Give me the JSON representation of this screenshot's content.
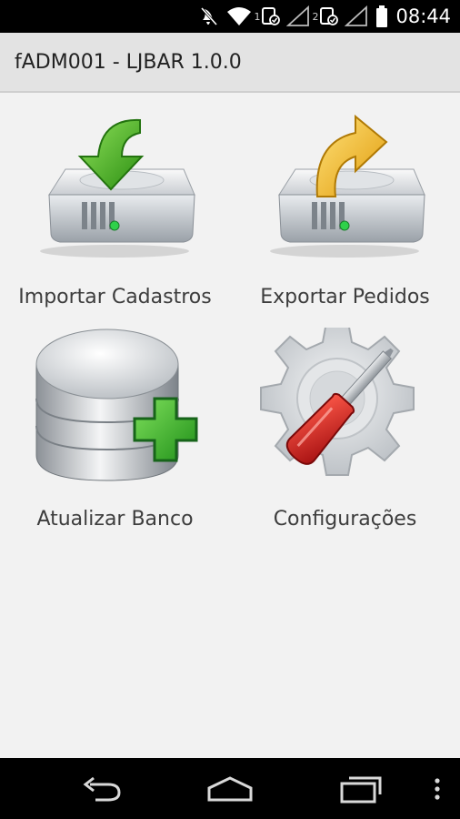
{
  "status_bar": {
    "sim1_label": "1",
    "sim2_label": "2",
    "time": "08:44",
    "icons": [
      "mute-icon",
      "wifi-icon",
      "signal-icon",
      "battery-icon"
    ]
  },
  "app": {
    "title": "fADM001 - LJBAR 1.0.0"
  },
  "menu": {
    "items": [
      {
        "label": "Importar Cadastros",
        "icon": "hdd-download-icon"
      },
      {
        "label": "Exportar Pedidos",
        "icon": "hdd-upload-icon"
      },
      {
        "label": "Atualizar Banco",
        "icon": "database-add-icon"
      },
      {
        "label": "Configurações",
        "icon": "gear-screwdriver-icon"
      }
    ]
  },
  "nav_bar": {
    "buttons": [
      "back-icon",
      "home-icon",
      "recents-icon",
      "overflow-menu-icon"
    ]
  },
  "colors": {
    "status_bar": "#000000",
    "action_bar": "#e3e3e3",
    "background": "#f2f2f2",
    "green_arrow": "#3fae1e",
    "yellow_arrow": "#f2b51c",
    "screwdriver_red": "#d42020"
  }
}
